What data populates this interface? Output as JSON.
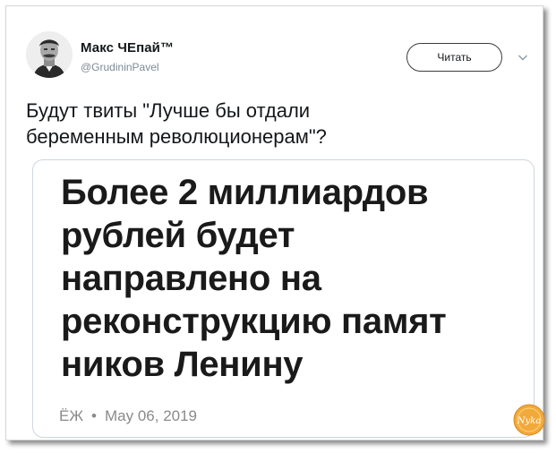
{
  "tweet": {
    "author_name": "Макс ЧЕпай™",
    "author_handle": "@GrudininPavel",
    "follow_label": "Читать",
    "text": "Будут твиты \"Лучше бы отдали\nбеременным революционерам\"?"
  },
  "card": {
    "headline": "Более 2 миллиардов\nрублей будет\nнаправлено на\nреконструкцию памят\nников Ленину",
    "source": "ЁЖ",
    "separator": "•",
    "date": "May 06, 2019"
  },
  "watermark": {
    "text": "Nyka",
    "color": "#f2a93b"
  },
  "icons": {
    "avatar": "avatar-photo",
    "menu": "chevron-down-icon"
  }
}
